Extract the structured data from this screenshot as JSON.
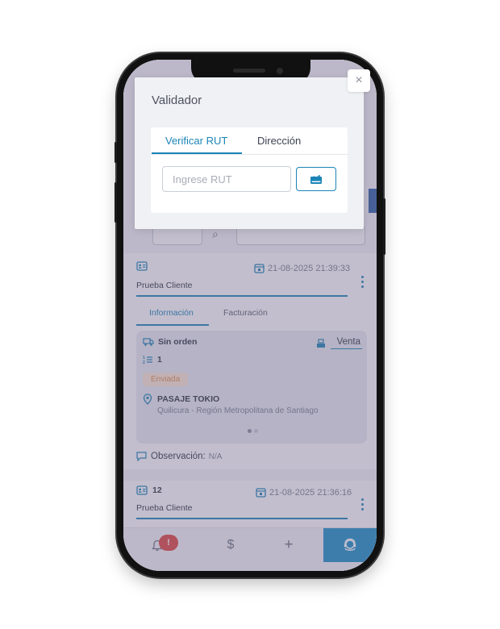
{
  "modal": {
    "title": "Validador",
    "close_symbol": "×",
    "tabs": [
      {
        "label": "Verificar RUT",
        "active": true
      },
      {
        "label": "Dirección",
        "active": false
      }
    ],
    "rut_input": {
      "placeholder": "Ingrese RUT",
      "value": ""
    },
    "verify_button_icon": "id-card-check-icon"
  },
  "orders": [
    {
      "client": "Prueba Cliente",
      "datetime": "21-08-2025 21:39:33",
      "subtabs": [
        "Información",
        "Facturación"
      ],
      "info": {
        "order_status": "Sin orden",
        "items_count": "1",
        "badge": "Enviada",
        "sale_type": "Venta",
        "address_title": "PASAJE TOKIO",
        "address_detail": "Quilicura - Región Metropolitana de Santiago"
      },
      "observation_label": "Observación:",
      "observation_value": "N/A"
    },
    {
      "id": "12",
      "client": "Prueba Cliente",
      "datetime": "21-08-2025 21:36:16"
    }
  ],
  "bottom_nav": {
    "notification_count": "!",
    "items": [
      "bell-icon",
      "dollar-icon",
      "plus-icon",
      "support-agent-icon"
    ],
    "dollar_symbol": "$",
    "plus_symbol": "+"
  },
  "colors": {
    "accent": "#1b84b7",
    "badge_text": "#e39149",
    "badge_bg": "#fde8d6",
    "notification": "#e0453f",
    "overlay": "rgba(110,100,135,0.42)"
  }
}
